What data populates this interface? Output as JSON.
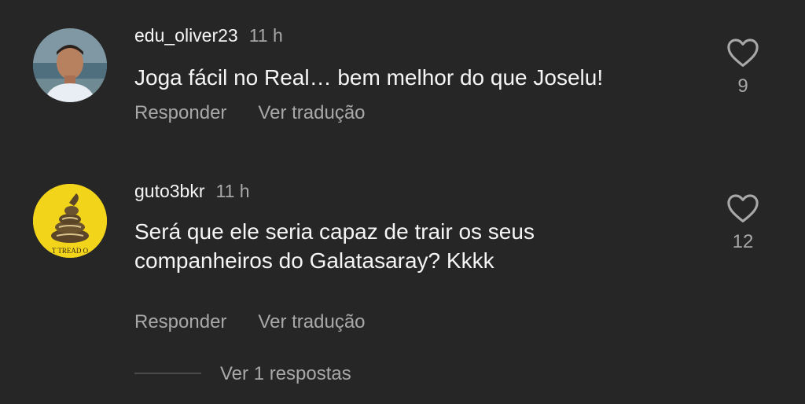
{
  "comments": [
    {
      "username": "edu_oliver23",
      "time": "11 h",
      "text": "Joga fácil no Real… bem melhor do que Joselu!",
      "reply_label": "Responder",
      "translate_label": "Ver tradução",
      "likes": "9"
    },
    {
      "username": "guto3bkr",
      "time": "11 h",
      "text": "Será que ele seria capaz de trair os seus companheiros do Galatasaray? Kkkk",
      "reply_label": "Responder",
      "translate_label": "Ver tradução",
      "likes": "12",
      "avatar_text": "T TREAD O"
    }
  ],
  "view_replies_label": "Ver 1 respostas",
  "colors": {
    "background": "#262626",
    "primary_text": "#f5f5f5",
    "secondary_text": "#a8a8a8",
    "avatar_yellow": "#f2d41a"
  }
}
